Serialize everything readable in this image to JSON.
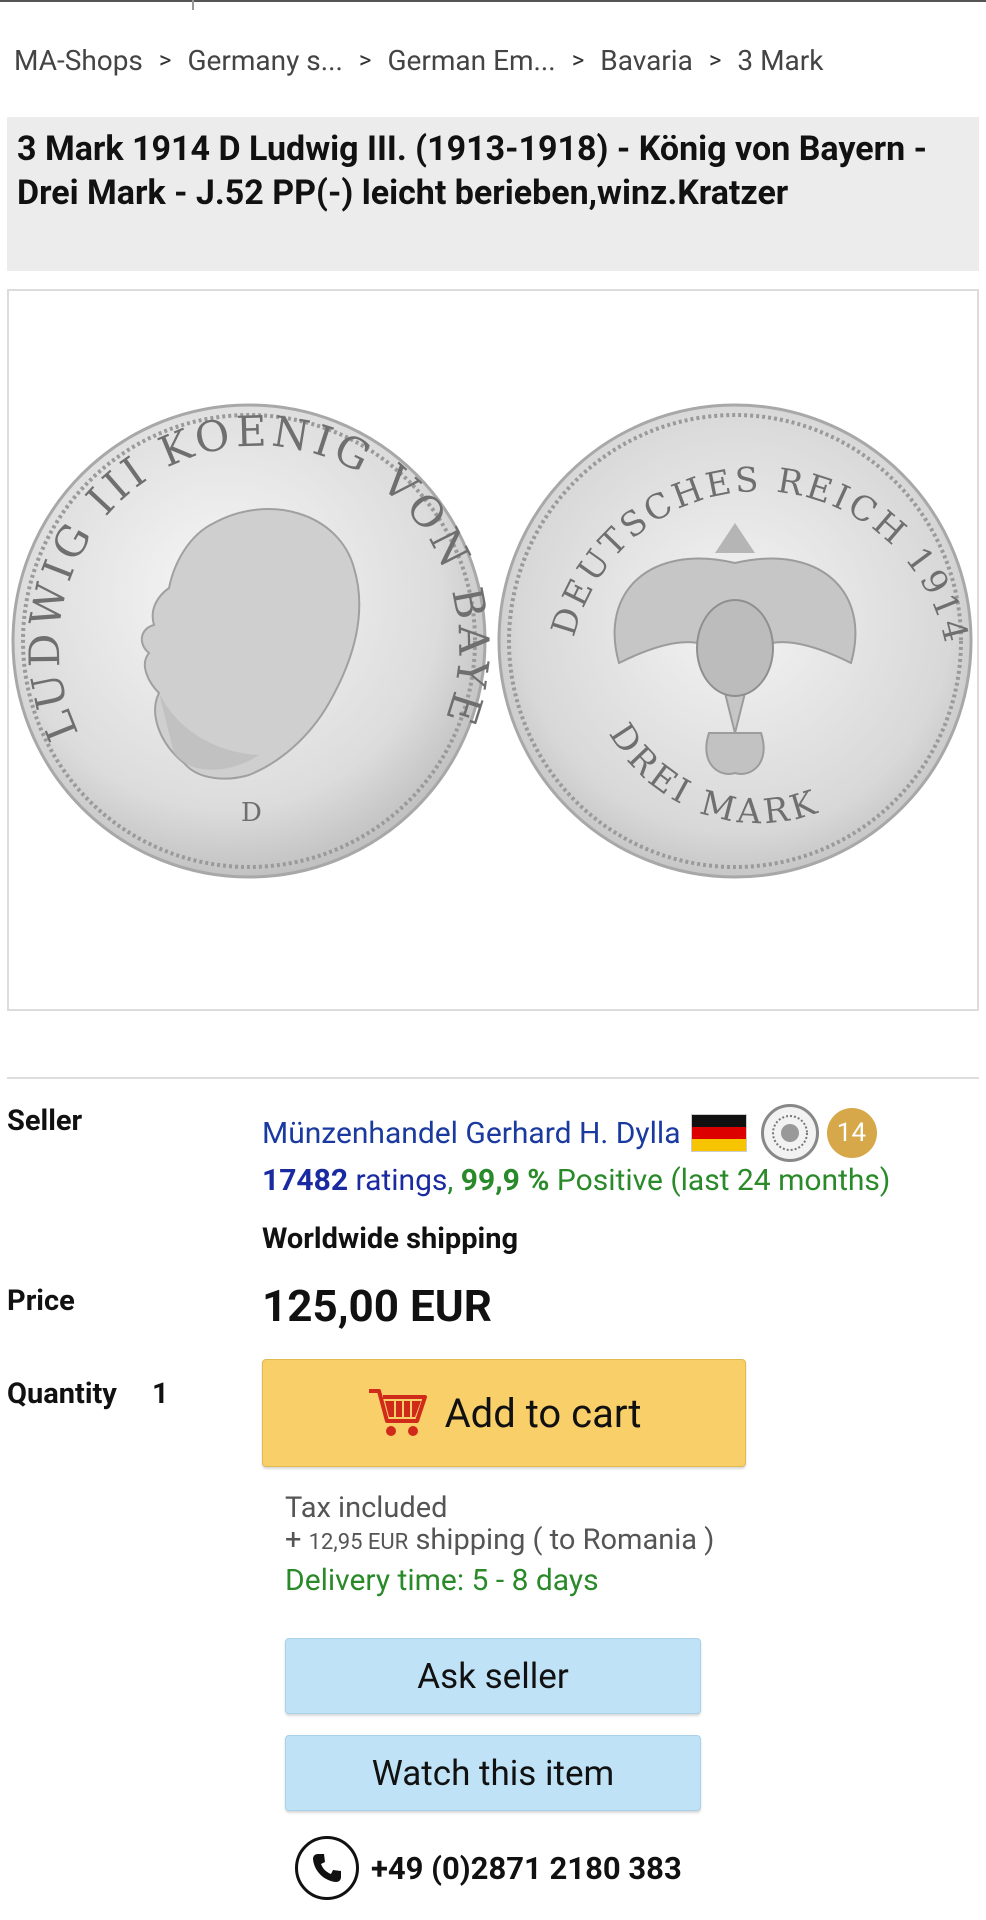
{
  "breadcrumb": [
    "MA-Shops",
    "Germany s...",
    "German Em...",
    "Bavaria",
    "3 Mark"
  ],
  "breadcrumb_separator": ">",
  "title": "3 Mark 1914 D Ludwig III. (1913-1918) - König von Bayern - Drei Mark - J.52 PP(-) leicht berieben,winz.Kratzer",
  "coin": {
    "obverse_legend": "LUDWIG III KOENIG VON BAYERN",
    "obverse_mint": "D",
    "reverse_top": "DEUTSCHES REICH 1914",
    "reverse_bottom": "DREI MARK"
  },
  "seller": {
    "label": "Seller",
    "name": "Münzenhandel Gerhard H. Dylla",
    "badge_count": "14",
    "ratings_count": "17482",
    "ratings_word": "ratings",
    "ratings_comma": ",",
    "positive_pct": "99,9 %",
    "positive_text": "Positive (last 24 months)",
    "shipping_scope": "Worldwide shipping"
  },
  "price": {
    "label": "Price",
    "value": "125,00 EUR"
  },
  "quantity": {
    "label": "Quantity",
    "value": "1"
  },
  "buttons": {
    "add_to_cart": "Add to cart",
    "ask_seller": "Ask seller",
    "watch_item": "Watch this item"
  },
  "shipping": {
    "tax": "Tax included",
    "plus": "+",
    "cost": "12,95 EUR",
    "text": "shipping ( to Romania )",
    "delivery": "Delivery time: 5 - 8 days"
  },
  "phone": "+49 (0)2871 2180 383",
  "colors": {
    "link_blue": "#1a3aa0",
    "positive_green": "#2a8a2a",
    "cart_yellow": "#f8cf68",
    "secondary_blue": "#bfe2f6",
    "badge_gold": "#d6a84a"
  },
  "icons": [
    "cart-icon",
    "phone-icon",
    "germany-flag-icon",
    "seal-icon"
  ]
}
